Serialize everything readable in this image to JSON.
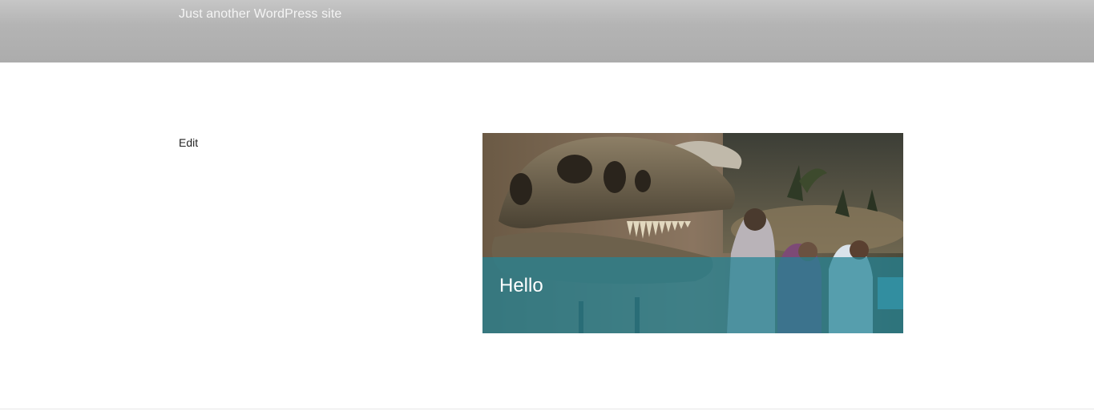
{
  "header": {
    "site_description": "Just another WordPress site"
  },
  "main": {
    "edit_label": "Edit",
    "featured": {
      "title": "Hello",
      "image_subject": "dinosaur skull museum exhibit with visitors",
      "band_color": "#228496"
    }
  }
}
